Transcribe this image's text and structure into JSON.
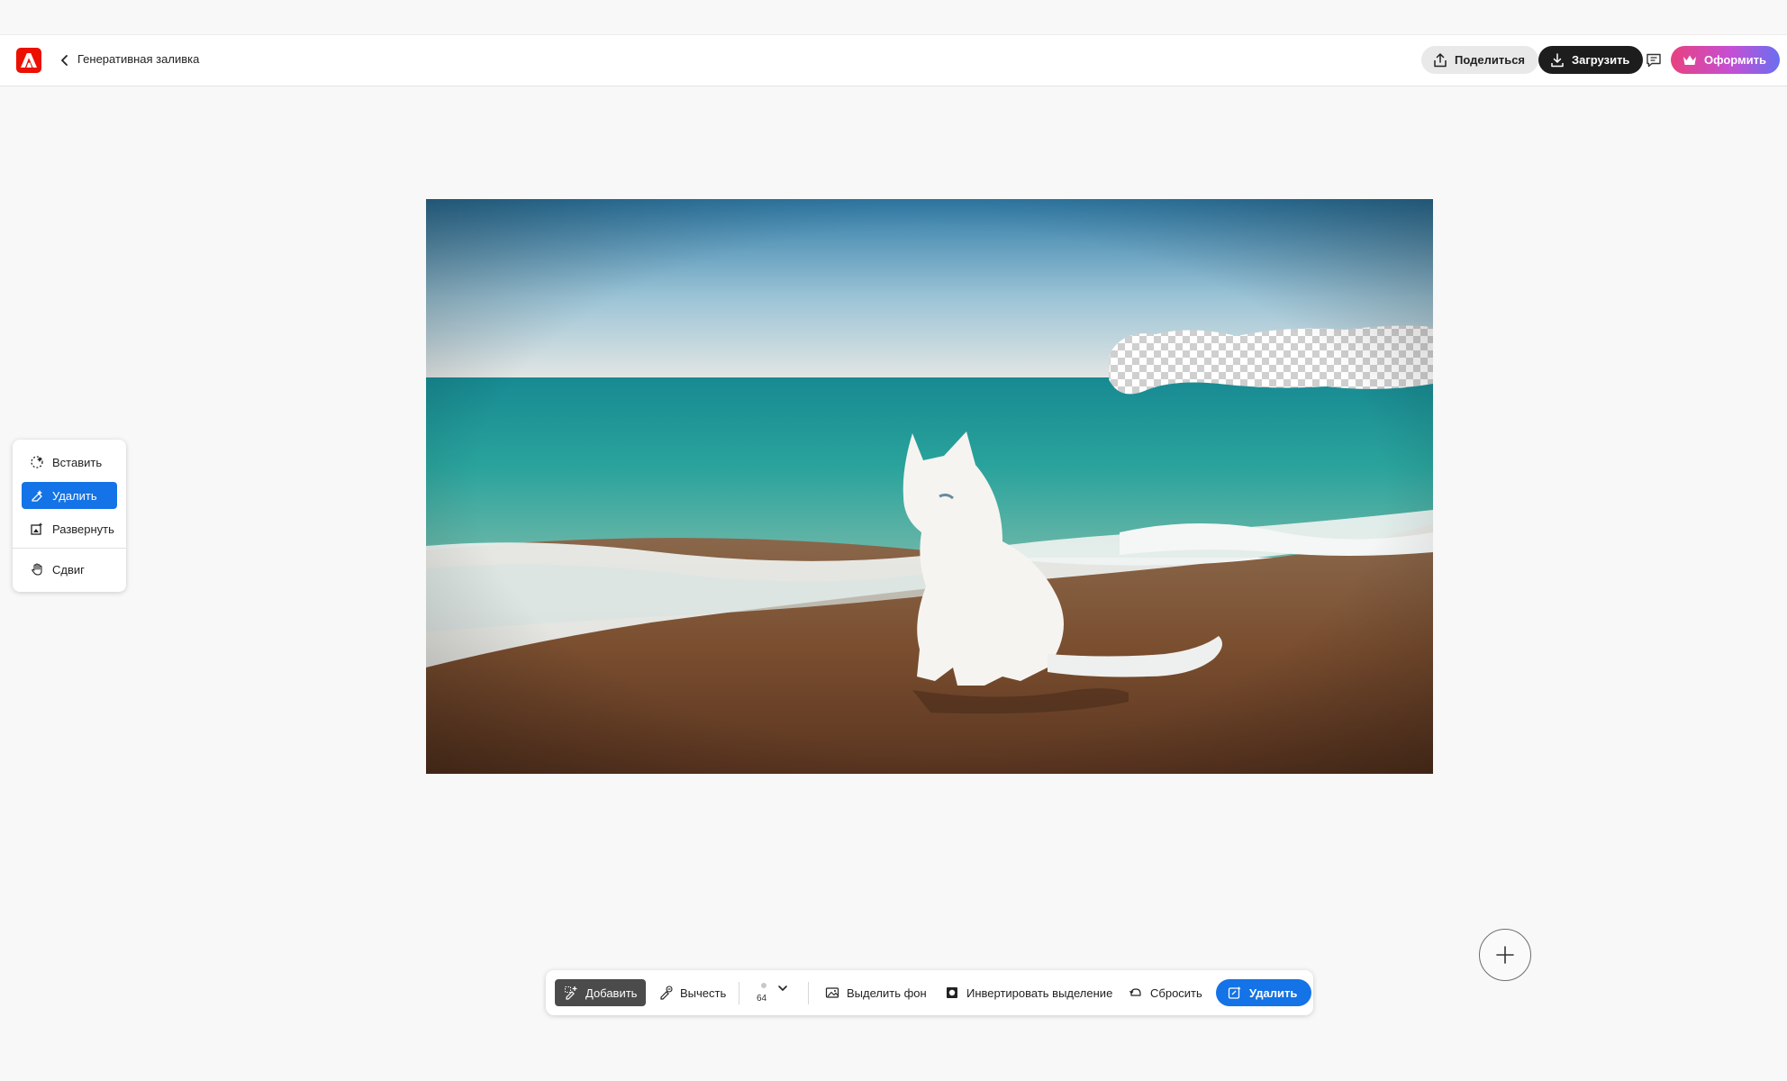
{
  "header": {
    "app_logo": "adobe-logo",
    "doc_title": "Генеративная заливка",
    "share_label": "Поделиться",
    "download_label": "Загрузить",
    "subscribe_label": "Оформить"
  },
  "side_tools": {
    "items": [
      {
        "label": "Вставить",
        "icon": "insert-icon"
      },
      {
        "label": "Удалить",
        "icon": "remove-icon",
        "active": true
      },
      {
        "label": "Развернуть",
        "icon": "expand-icon"
      },
      {
        "label": "Сдвиг",
        "icon": "hand-icon"
      }
    ]
  },
  "toolbar": {
    "add_label": "Добавить",
    "subtract_label": "Вычесть",
    "brush_size": "64",
    "select_bg_label": "Выделить фон",
    "invert_label": "Инвертировать выделение",
    "reset_label": "Сбросить",
    "remove_label": "Удалить"
  },
  "colors": {
    "accent": "#1473e6",
    "brand": "#eb1000",
    "subscribe_gradient": [
      "#e8417f",
      "#c54fd4",
      "#6a6ff0"
    ]
  }
}
